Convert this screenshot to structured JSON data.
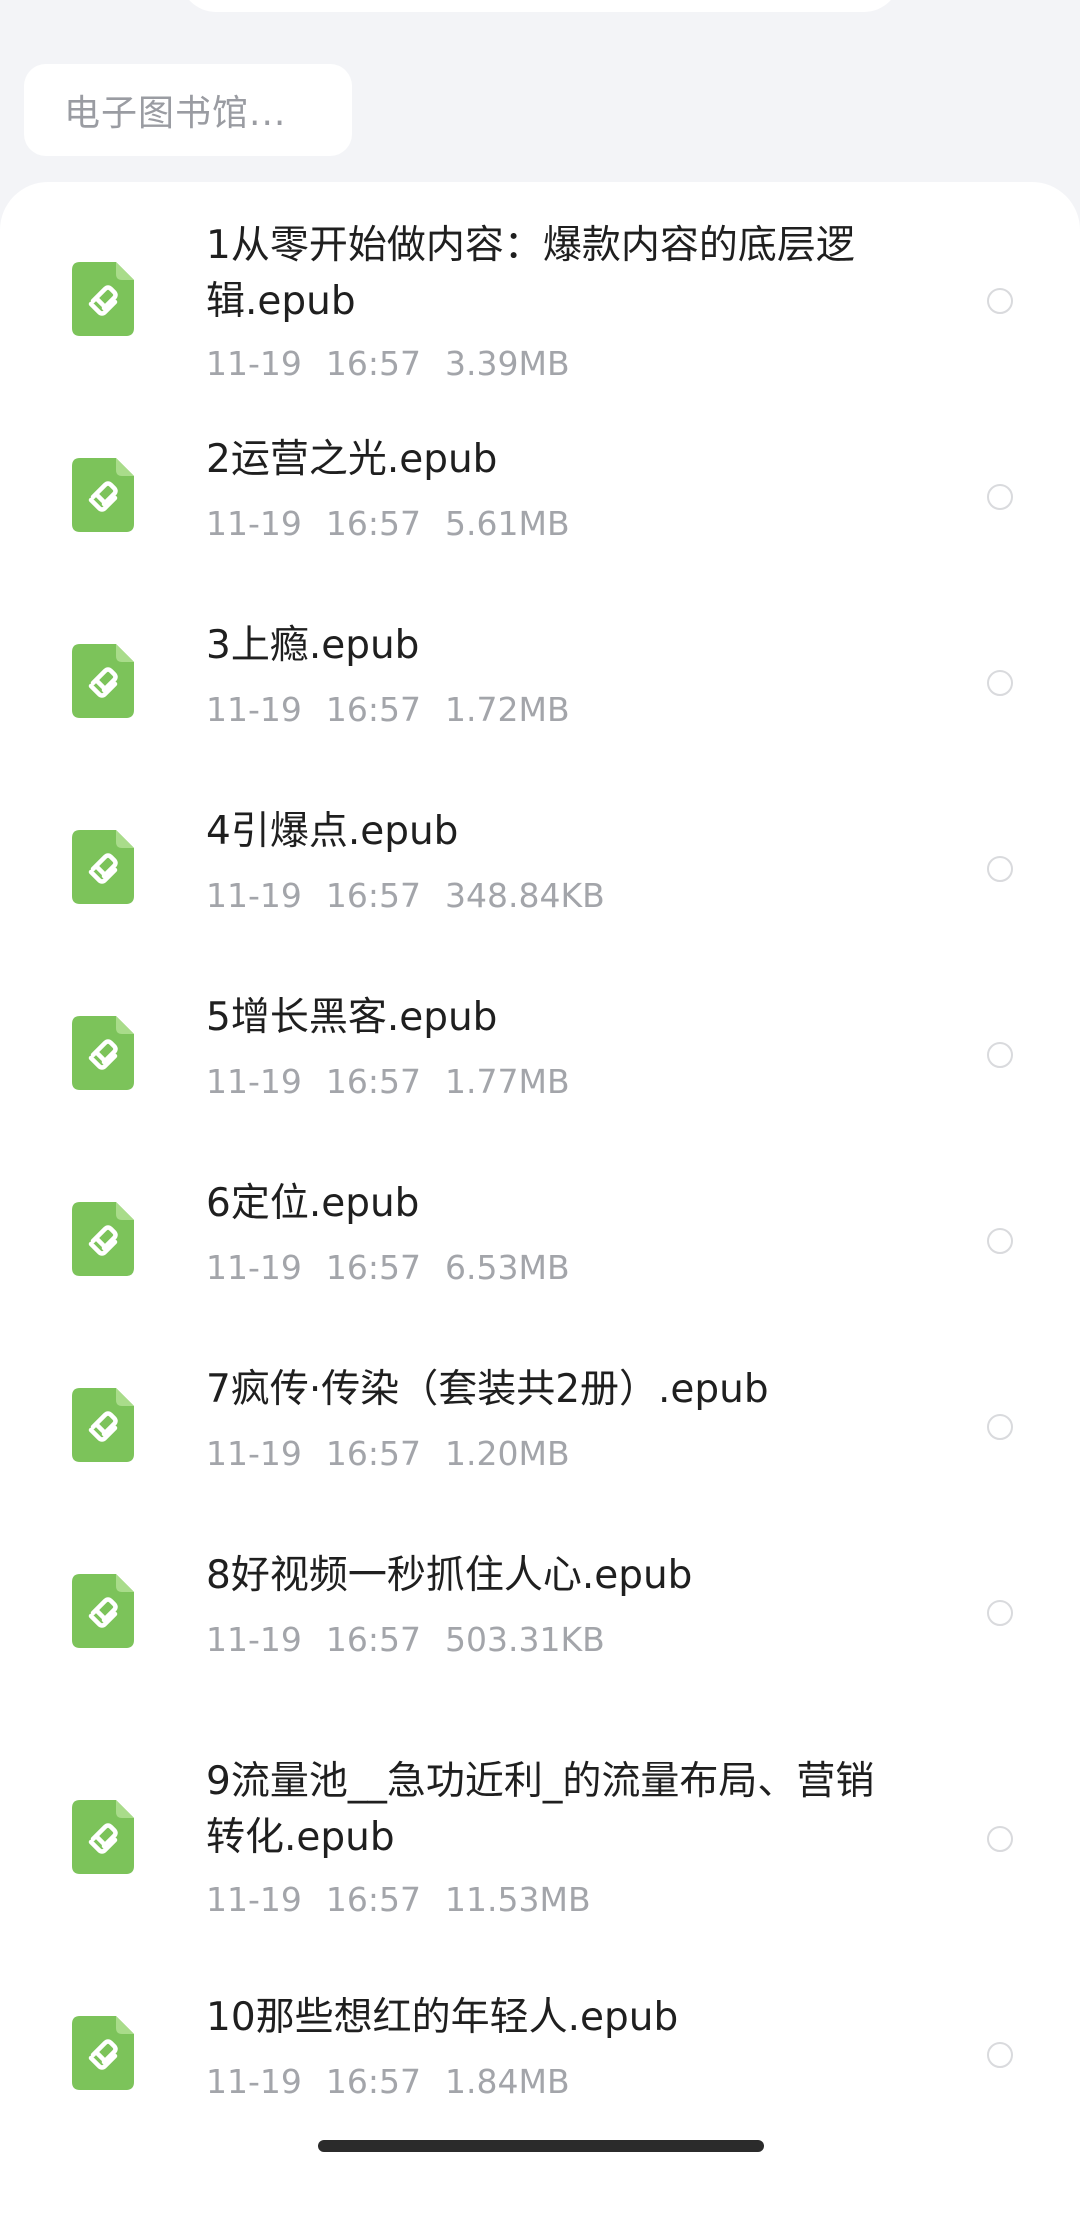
{
  "breadcrumb": {
    "label": "电子图书馆..."
  },
  "colors": {
    "icon_green": "#7cc35a",
    "text_primary": "#1f1f1f",
    "text_secondary": "#a3a5aa"
  },
  "files": [
    {
      "name": "1从零开始做内容：爆款内容的底层逻辑.epub",
      "date": "11-19",
      "time": "16:57",
      "size": "3.39MB",
      "icon": "epub-file-icon"
    },
    {
      "name": "2运营之光.epub",
      "date": "11-19",
      "time": "16:57",
      "size": "5.61MB",
      "icon": "epub-file-icon"
    },
    {
      "name": "3上瘾.epub",
      "date": "11-19",
      "time": "16:57",
      "size": "1.72MB",
      "icon": "epub-file-icon"
    },
    {
      "name": "4引爆点.epub",
      "date": "11-19",
      "time": "16:57",
      "size": "348.84KB",
      "icon": "epub-file-icon"
    },
    {
      "name": "5增长黑客.epub",
      "date": "11-19",
      "time": "16:57",
      "size": "1.77MB",
      "icon": "epub-file-icon"
    },
    {
      "name": "6定位.epub",
      "date": "11-19",
      "time": "16:57",
      "size": "6.53MB",
      "icon": "epub-file-icon"
    },
    {
      "name": "7疯传·传染（套装共2册）.epub",
      "date": "11-19",
      "time": "16:57",
      "size": "1.20MB",
      "icon": "epub-file-icon"
    },
    {
      "name": "8好视频一秒抓住人心.epub",
      "date": "11-19",
      "time": "16:57",
      "size": "503.31KB",
      "icon": "epub-file-icon"
    },
    {
      "name": "9流量池__急功近利_的流量布局、营销转化.epub",
      "date": "11-19",
      "time": "16:57",
      "size": "11.53MB",
      "icon": "epub-file-icon"
    },
    {
      "name": "10那些想红的年轻人.epub",
      "date": "11-19",
      "time": "16:57",
      "size": "1.84MB",
      "icon": "epub-file-icon"
    }
  ]
}
